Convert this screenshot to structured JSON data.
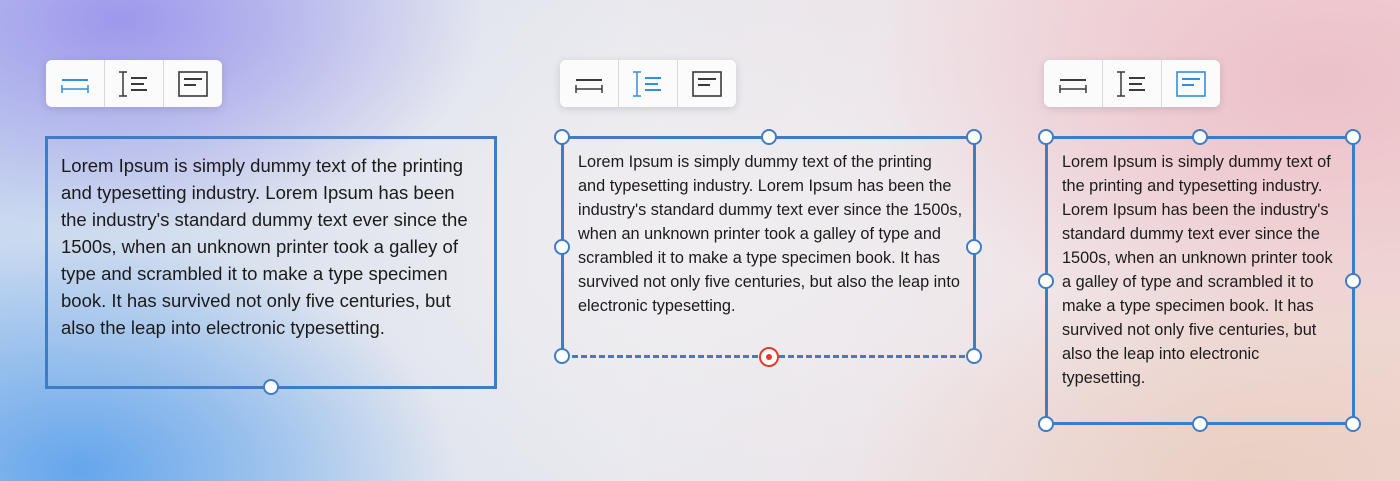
{
  "colors": {
    "accent": "#3f7cc6",
    "icon_active": "#2f8fe0",
    "icon_inactive": "#3a3a3a",
    "handle_active": "#e23b27"
  },
  "toolbar_icons": [
    "auto-width-icon",
    "auto-height-icon",
    "fixed-size-icon"
  ],
  "panels": [
    {
      "mode": "auto-width",
      "active_tool": 0,
      "text": "Lorem Ipsum is simply dummy text of the printing and typesetting industry. Lorem Ipsum has been the industry's standard dummy text ever since the 1500s, when an unknown printer took a galley of type and scrambled it to make a type specimen book. It has survived not only five centuries, but also the leap into electronic typesetting."
    },
    {
      "mode": "auto-height",
      "active_tool": 1,
      "text": "Lorem Ipsum is simply dummy text of the printing and typesetting industry. Lorem Ipsum has been the industry's standard dummy text ever since the 1500s, when an unknown printer took a galley of type and scrambled it to make a type specimen book. It has survived not only five centuries, but also the leap into electronic typesetting."
    },
    {
      "mode": "fixed-size",
      "active_tool": 2,
      "text": "Lorem Ipsum is simply dummy text of the printing and typesetting industry. Lorem Ipsum has been the industry's standard dummy text ever since the 1500s, when an unknown printer took a galley of type and scrambled it to make a type specimen book. It has survived not only five centuries, but also the leap into electronic typesetting."
    }
  ]
}
